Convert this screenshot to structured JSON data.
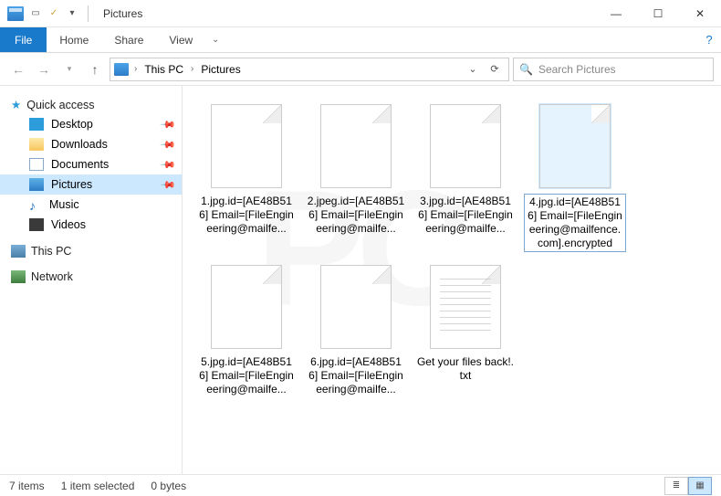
{
  "titlebar": {
    "title": "Pictures"
  },
  "ribbon": {
    "file": "File",
    "tabs": [
      "Home",
      "Share",
      "View"
    ]
  },
  "address": {
    "crumbs": [
      "This PC",
      "Pictures"
    ]
  },
  "search": {
    "placeholder": "Search Pictures"
  },
  "navpane": {
    "quick_access": "Quick access",
    "items": [
      {
        "label": "Desktop",
        "pinned": true,
        "icon": "desktop"
      },
      {
        "label": "Downloads",
        "pinned": true,
        "icon": "folder"
      },
      {
        "label": "Documents",
        "pinned": true,
        "icon": "doc"
      },
      {
        "label": "Pictures",
        "pinned": true,
        "icon": "pic",
        "selected": true
      },
      {
        "label": "Music",
        "pinned": false,
        "icon": "music"
      },
      {
        "label": "Videos",
        "pinned": false,
        "icon": "video"
      }
    ],
    "this_pc": "This PC",
    "network": "Network"
  },
  "files": [
    {
      "name": "1.jpg.id=[AE48B516] Email=[FileEngineering@mailfe...",
      "type": "blank"
    },
    {
      "name": "2.jpeg.id=[AE48B516] Email=[FileEngineering@mailfe...",
      "type": "blank"
    },
    {
      "name": "3.jpg.id=[AE48B516] Email=[FileEngineering@mailfe...",
      "type": "blank"
    },
    {
      "name": "4.jpg.id=[AE48B516] Email=[FileEngineering@mailfence.com].encrypted",
      "type": "blank",
      "selected": true
    },
    {
      "name": "5.jpg.id=[AE48B516] Email=[FileEngineering@mailfe...",
      "type": "blank"
    },
    {
      "name": "6.jpg.id=[AE48B516] Email=[FileEngineering@mailfe...",
      "type": "blank"
    },
    {
      "name": "Get your files back!.txt",
      "type": "txt"
    }
  ],
  "status": {
    "count": "7 items",
    "selection": "1 item selected",
    "size": "0 bytes"
  }
}
